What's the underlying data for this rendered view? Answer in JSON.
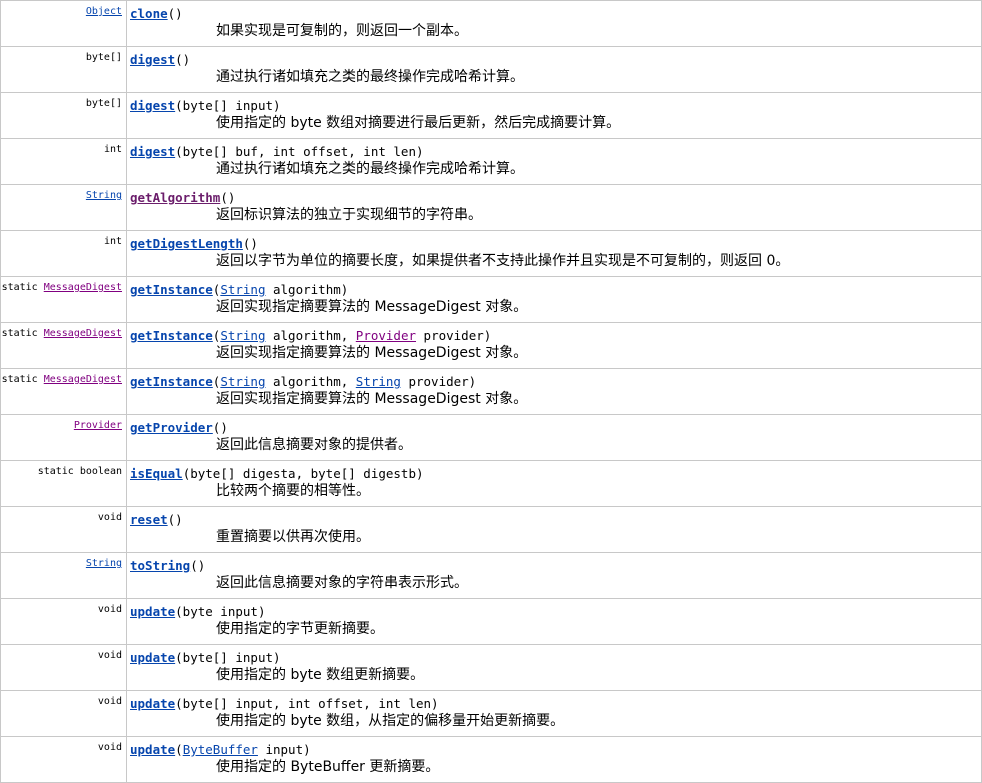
{
  "methods": [
    {
      "static": "",
      "ret": "Object",
      "ret_is_link": true,
      "ret_visited": false,
      "name": "clone",
      "name_visited": false,
      "params": [
        {
          "text": "()",
          "link": false
        }
      ],
      "desc": "如果实现是可复制的，则返回一个副本。"
    },
    {
      "static": "",
      "ret": "byte[]",
      "ret_is_link": false,
      "ret_visited": false,
      "name": "digest",
      "name_visited": false,
      "params": [
        {
          "text": "()",
          "link": false
        }
      ],
      "desc": "通过执行诸如填充之类的最终操作完成哈希计算。"
    },
    {
      "static": "",
      "ret": "byte[]",
      "ret_is_link": false,
      "ret_visited": false,
      "name": "digest",
      "name_visited": false,
      "params": [
        {
          "text": "(byte[] input)",
          "link": false
        }
      ],
      "desc": "使用指定的 byte 数组对摘要进行最后更新，然后完成摘要计算。"
    },
    {
      "static": "",
      "ret": "int",
      "ret_is_link": false,
      "ret_visited": false,
      "name": "digest",
      "name_visited": false,
      "params": [
        {
          "text": "(byte[] buf, int offset, int len)",
          "link": false
        }
      ],
      "desc": "通过执行诸如填充之类的最终操作完成哈希计算。"
    },
    {
      "static": "",
      "ret": "String",
      "ret_is_link": true,
      "ret_visited": false,
      "name": "getAlgorithm",
      "name_visited": true,
      "params": [
        {
          "text": "()",
          "link": false
        }
      ],
      "desc": "返回标识算法的独立于实现细节的字符串。"
    },
    {
      "static": "",
      "ret": "int",
      "ret_is_link": false,
      "ret_visited": false,
      "name": "getDigestLength",
      "name_visited": false,
      "params": [
        {
          "text": "()",
          "link": false
        }
      ],
      "desc": "返回以字节为单位的摘要长度，如果提供者不支持此操作并且实现是不可复制的，则返回 0。"
    },
    {
      "static": "static ",
      "ret": "MessageDigest",
      "ret_is_link": true,
      "ret_visited": true,
      "name": "getInstance",
      "name_visited": false,
      "params": [
        {
          "text": "(",
          "link": false
        },
        {
          "text": "String",
          "link": true,
          "visited": false
        },
        {
          "text": " algorithm)",
          "link": false
        }
      ],
      "desc": "返回实现指定摘要算法的 MessageDigest 对象。"
    },
    {
      "static": "static ",
      "ret": "MessageDigest",
      "ret_is_link": true,
      "ret_visited": true,
      "name": "getInstance",
      "name_visited": false,
      "params": [
        {
          "text": "(",
          "link": false
        },
        {
          "text": "String",
          "link": true,
          "visited": false
        },
        {
          "text": " algorithm, ",
          "link": false
        },
        {
          "text": "Provider",
          "link": true,
          "visited": true
        },
        {
          "text": " provider)",
          "link": false
        }
      ],
      "desc": "返回实现指定摘要算法的 MessageDigest 对象。"
    },
    {
      "static": "static ",
      "ret": "MessageDigest",
      "ret_is_link": true,
      "ret_visited": true,
      "name": "getInstance",
      "name_visited": false,
      "params": [
        {
          "text": "(",
          "link": false
        },
        {
          "text": "String",
          "link": true,
          "visited": false
        },
        {
          "text": " algorithm, ",
          "link": false
        },
        {
          "text": "String",
          "link": true,
          "visited": false
        },
        {
          "text": " provider)",
          "link": false
        }
      ],
      "desc": "返回实现指定摘要算法的 MessageDigest 对象。"
    },
    {
      "static": "",
      "ret": "Provider",
      "ret_is_link": true,
      "ret_visited": true,
      "name": "getProvider",
      "name_visited": false,
      "params": [
        {
          "text": "()",
          "link": false
        }
      ],
      "desc": "返回此信息摘要对象的提供者。"
    },
    {
      "static": "static ",
      "ret": "boolean",
      "ret_is_link": false,
      "ret_visited": false,
      "name": "isEqual",
      "name_visited": false,
      "params": [
        {
          "text": "(byte[] digesta, byte[] digestb)",
          "link": false
        }
      ],
      "desc": "比较两个摘要的相等性。"
    },
    {
      "static": "",
      "ret": "void",
      "ret_is_link": false,
      "ret_visited": false,
      "name": "reset",
      "name_visited": false,
      "params": [
        {
          "text": "()",
          "link": false
        }
      ],
      "desc": "重置摘要以供再次使用。"
    },
    {
      "static": "",
      "ret": "String",
      "ret_is_link": true,
      "ret_visited": false,
      "name": "toString",
      "name_visited": false,
      "params": [
        {
          "text": "()",
          "link": false
        }
      ],
      "desc": "返回此信息摘要对象的字符串表示形式。"
    },
    {
      "static": "",
      "ret": "void",
      "ret_is_link": false,
      "ret_visited": false,
      "name": "update",
      "name_visited": false,
      "params": [
        {
          "text": "(byte input)",
          "link": false
        }
      ],
      "desc": "使用指定的字节更新摘要。"
    },
    {
      "static": "",
      "ret": "void",
      "ret_is_link": false,
      "ret_visited": false,
      "name": "update",
      "name_visited": false,
      "params": [
        {
          "text": "(byte[] input)",
          "link": false
        }
      ],
      "desc": "使用指定的 byte 数组更新摘要。"
    },
    {
      "static": "",
      "ret": "void",
      "ret_is_link": false,
      "ret_visited": false,
      "name": "update",
      "name_visited": false,
      "params": [
        {
          "text": "(byte[] input, int offset, int len)",
          "link": false
        }
      ],
      "desc": "使用指定的 byte 数组，从指定的偏移量开始更新摘要。"
    },
    {
      "static": "",
      "ret": "void",
      "ret_is_link": false,
      "ret_visited": false,
      "name": "update",
      "name_visited": false,
      "params": [
        {
          "text": "(",
          "link": false
        },
        {
          "text": "ByteBuffer",
          "link": true,
          "visited": false
        },
        {
          "text": " input)",
          "link": false
        }
      ],
      "desc": "使用指定的 ByteBuffer 更新摘要。"
    }
  ]
}
